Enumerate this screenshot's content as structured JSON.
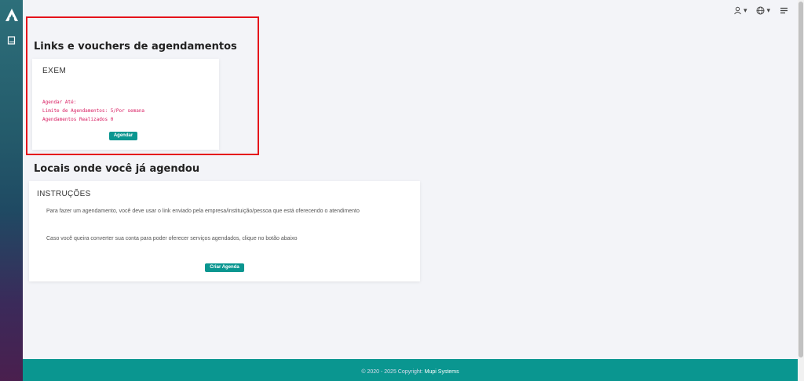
{
  "sidebar": {
    "logo_icon": "logo-a-icon",
    "nav_icon": "book-icon"
  },
  "topbar": {
    "user_icon": "user-icon",
    "globe_icon": "globe-icon",
    "menu_icon": "menu-icon"
  },
  "vouchers": {
    "title": "Links e vouchers de agendamentos",
    "card": {
      "name": "EXEM",
      "line1": "Agendar Até:",
      "line2": "Limite de Agendamentos: 5/Por semana",
      "line3": "Agendamentos Realizados 0",
      "button": "Agendar"
    }
  },
  "locais": {
    "title": "Locais onde você já agendou",
    "instr_title": "INSTRUÇÕES",
    "instr_text1": "Para fazer um agendamento, você deve usar o link enviado pela empresa/instituição/pessoa que está oferecendo o atendimento",
    "instr_text2": "Caso você queira converter sua conta para poder oferecer serviços agendados, clique no botão abaixo",
    "button": "Criar Agenda"
  },
  "footer": {
    "copyright": "© 2020 - 2025 Copyright:",
    "brand": "Mupi Systems"
  },
  "colors": {
    "accent": "#0a9690",
    "highlight": "#e5121b",
    "voucher_text": "#d81b60"
  }
}
